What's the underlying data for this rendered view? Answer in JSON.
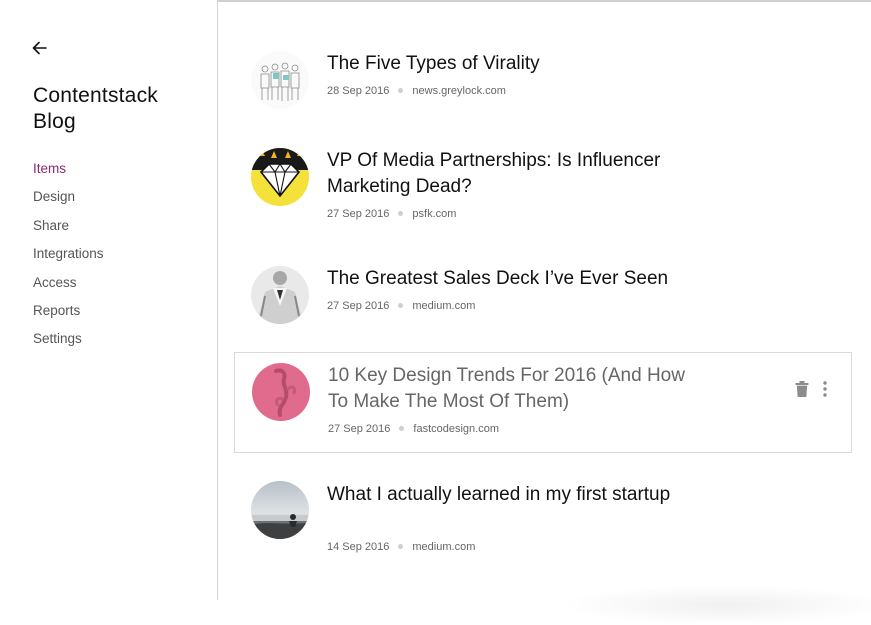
{
  "sidebar": {
    "back_icon": "arrow-left-icon",
    "title": "Contentstack Blog",
    "nav": [
      {
        "label": "Items",
        "active": true
      },
      {
        "label": "Design",
        "active": false
      },
      {
        "label": "Share",
        "active": false
      },
      {
        "label": "Integrations",
        "active": false
      },
      {
        "label": "Access",
        "active": false
      },
      {
        "label": "Reports",
        "active": false
      },
      {
        "label": "Settings",
        "active": false
      }
    ]
  },
  "colors": {
    "accent": "#8a2a6e",
    "text": "#111111",
    "muted": "#666666",
    "border": "#d9d9d9"
  },
  "items": [
    {
      "title": "The Five Types of Virality",
      "date": "28 Sep 2016",
      "source": "news.greylock.com"
    },
    {
      "title": "VP Of Media Partnerships: Is Influencer Marketing Dead?",
      "date": "27 Sep 2016",
      "source": "psfk.com"
    },
    {
      "title": "The Greatest Sales Deck I’ve Ever Seen",
      "date": "27 Sep 2016",
      "source": "medium.com"
    },
    {
      "title": "10 Key Design Trends For 2016 (And How To Make The Most Of Them)",
      "date": "27 Sep 2016",
      "source": "fastcodesign.com",
      "hovered": true
    },
    {
      "title": "What I actually learned in my first startup",
      "date": "14 Sep 2016",
      "source": "medium.com"
    }
  ],
  "item_actions": {
    "delete_icon": "trash-icon",
    "more_icon": "more-vertical-icon"
  }
}
